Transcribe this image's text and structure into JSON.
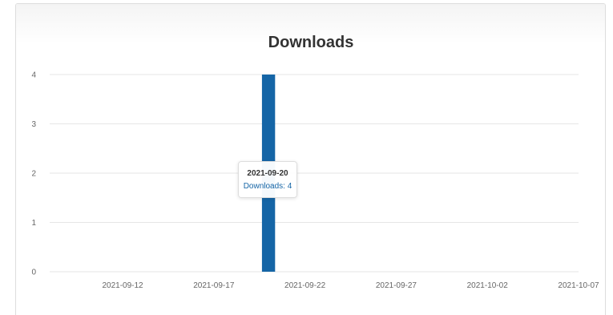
{
  "chart_data": {
    "type": "bar",
    "title": "Downloads",
    "xlabel": "",
    "ylabel": "",
    "x_axis_type": "date",
    "x_range": [
      "2021-09-08",
      "2021-10-07"
    ],
    "x_ticks": [
      "2021-09-12",
      "2021-09-17",
      "2021-09-22",
      "2021-09-27",
      "2021-10-02",
      "2021-10-07"
    ],
    "y_ticks": [
      0,
      1,
      2,
      3,
      4
    ],
    "ylim": [
      0,
      4
    ],
    "grid": true,
    "series": [
      {
        "name": "Downloads",
        "color": "#1565a6",
        "points": [
          {
            "x": "2021-09-20",
            "y": 4
          }
        ]
      }
    ]
  },
  "tooltip": {
    "date": "2021-09-20",
    "value_text": "Downloads: 4"
  }
}
